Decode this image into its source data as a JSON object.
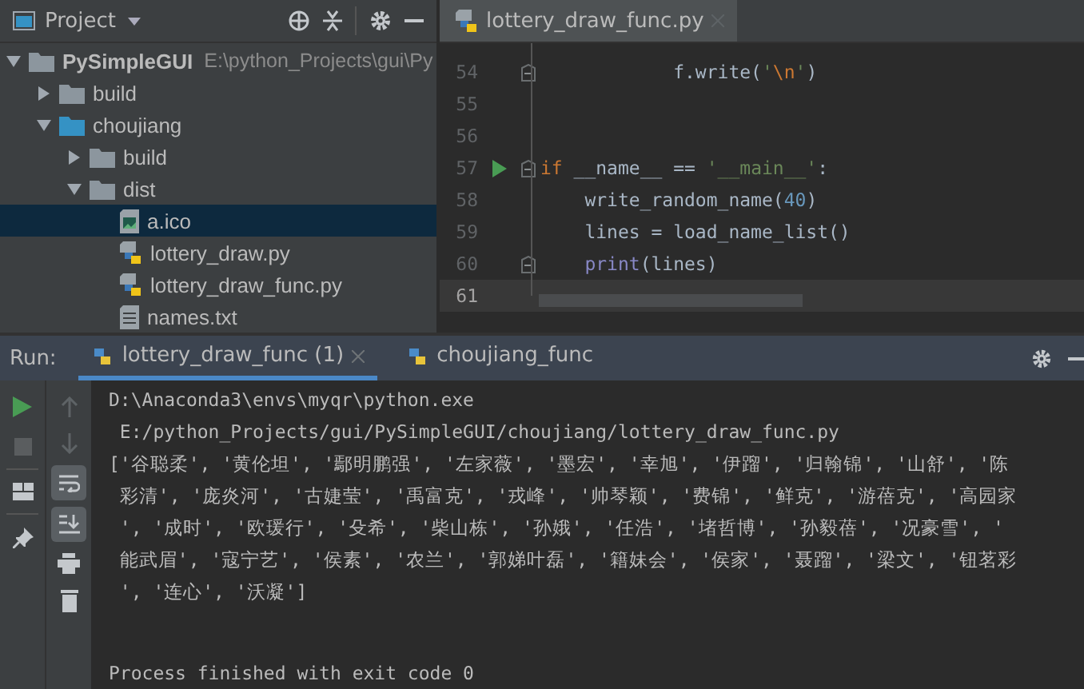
{
  "project_panel": {
    "title": "Project",
    "tree": [
      {
        "name": "PySimpleGUI",
        "path": "E:\\python_Projects\\gui\\Py",
        "kind": "folder",
        "expanded": true,
        "selected": false,
        "children": [
          {
            "name": "build",
            "kind": "folder",
            "expanded": false,
            "selected": false
          },
          {
            "name": "choujiang",
            "kind": "source-folder",
            "expanded": true,
            "selected": false,
            "children": [
              {
                "name": "build",
                "kind": "folder",
                "expanded": false,
                "selected": false
              },
              {
                "name": "dist",
                "kind": "folder",
                "expanded": true,
                "selected": false,
                "children": [
                  {
                    "name": "a.ico",
                    "kind": "image",
                    "selected": true
                  },
                  {
                    "name": "lottery_draw.py",
                    "kind": "python",
                    "selected": false
                  },
                  {
                    "name": "lottery_draw_func.py",
                    "kind": "python",
                    "selected": false
                  },
                  {
                    "name": "names.txt",
                    "kind": "text",
                    "selected": false
                  }
                ]
              }
            ]
          }
        ]
      }
    ]
  },
  "editor": {
    "tabs": [
      {
        "label": "lottery_draw_func.py",
        "selected": true
      }
    ],
    "lines": [
      {
        "number": "54",
        "fold": true,
        "run_marker": false,
        "current": false,
        "tokens": [
          {
            "kind": "plain",
            "text": "            f.write("
          },
          {
            "kind": "str",
            "text": "'"
          },
          {
            "kind": "esc",
            "text": "\\n"
          },
          {
            "kind": "str",
            "text": "'"
          },
          {
            "kind": "plain",
            "text": ")"
          }
        ]
      },
      {
        "number": "55",
        "fold": false,
        "run_marker": false,
        "current": false
      },
      {
        "number": "56",
        "fold": false,
        "run_marker": false,
        "current": false
      },
      {
        "number": "57",
        "fold": true,
        "run_marker": true,
        "current": false,
        "tokens": [
          {
            "kind": "kw",
            "text": "if"
          },
          {
            "kind": "plain",
            "text": " __name__ == "
          },
          {
            "kind": "str",
            "text": "'__main__'"
          },
          {
            "kind": "plain",
            "text": ":"
          }
        ]
      },
      {
        "number": "58",
        "fold": false,
        "run_marker": false,
        "current": false,
        "tokens": [
          {
            "kind": "plain",
            "text": "    write_random_name("
          },
          {
            "kind": "num",
            "text": "40"
          },
          {
            "kind": "plain",
            "text": ")"
          }
        ]
      },
      {
        "number": "59",
        "fold": false,
        "run_marker": false,
        "current": false,
        "tokens": [
          {
            "kind": "plain",
            "text": "    lines = load_name_list()"
          }
        ]
      },
      {
        "number": "60",
        "fold": true,
        "run_marker": false,
        "current": false,
        "tokens": [
          {
            "kind": "builtin",
            "text": "    print"
          },
          {
            "kind": "plain",
            "text": "(lines)"
          }
        ]
      },
      {
        "number": "61",
        "fold": false,
        "run_marker": false,
        "current": true
      }
    ]
  },
  "run_panel": {
    "label": "Run:",
    "tabs": [
      {
        "label": "lottery_draw_func (1)",
        "selected": true,
        "closable": true
      },
      {
        "label": "choujiang_func",
        "selected": false,
        "closable": false
      }
    ],
    "console": [
      "D:\\Anaconda3\\envs\\myqr\\python.exe",
      " E:/python_Projects/gui/PySimpleGUI/choujiang/lottery_draw_func.py",
      "['谷聪柔', '黄伦坦', '鄢明鹏强', '左家薇', '墨宏', '幸旭', '伊蹓', '归翰锦', '山舒', '陈",
      " 彩清', '庞炎河', '古婕莹', '禹富克', '戎峰', '帅琴颖', '费锦', '鲜克', '游蓓克', '高园家",
      " ', '成时', '欧瑗行', '殳希', '柴山栋', '孙娥', '任浩', '堵哲博', '孙毅蓓', '况豪雪', '",
      " 能武眉', '寇宁艺', '侯素', '农兰', '郭娣叶磊', '籍妹会', '侯家', '聂蹓', '梁文', '钮茗彩",
      " ', '连心', '沃凝']"
    ],
    "exit_message": "Process finished with exit code 0"
  }
}
